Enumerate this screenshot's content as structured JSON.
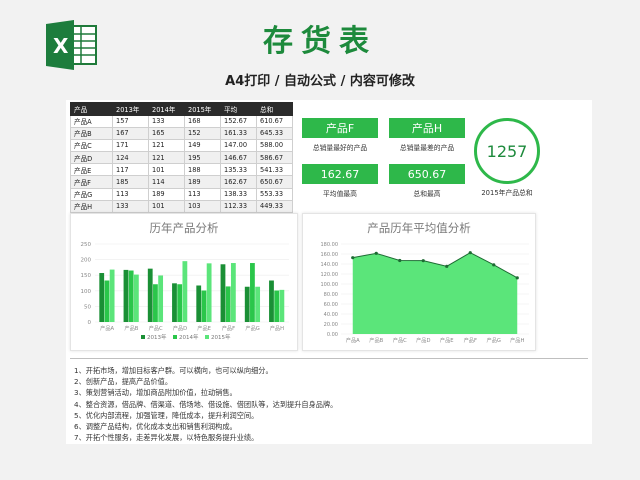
{
  "header": {
    "title": "存货表",
    "subtitle": "A4打印 / 自动公式 / 内容可修改",
    "logo_icon": "excel-logo-icon"
  },
  "colors": {
    "accent": "#2eb84a",
    "dark_green": "#1d8a3c",
    "series": [
      "#1a8f35",
      "#2ac64a",
      "#5be57a"
    ]
  },
  "table": {
    "headers": [
      "产品",
      "2013年",
      "2014年",
      "2015年",
      "平均",
      "总和"
    ],
    "rows": [
      [
        "产品A",
        "157",
        "133",
        "168",
        "152.67",
        "610.67"
      ],
      [
        "产品B",
        "167",
        "165",
        "152",
        "161.33",
        "645.33"
      ],
      [
        "产品C",
        "171",
        "121",
        "149",
        "147.00",
        "588.00"
      ],
      [
        "产品D",
        "124",
        "121",
        "195",
        "146.67",
        "586.67"
      ],
      [
        "产品E",
        "117",
        "101",
        "188",
        "135.33",
        "541.33"
      ],
      [
        "产品F",
        "185",
        "114",
        "189",
        "162.67",
        "650.67"
      ],
      [
        "产品G",
        "113",
        "189",
        "113",
        "138.33",
        "553.33"
      ],
      [
        "产品H",
        "133",
        "101",
        "103",
        "112.33",
        "449.33"
      ]
    ]
  },
  "kpis": {
    "best_seller": {
      "value": "产品F",
      "caption": "总销量最好的产品"
    },
    "worst_seller": {
      "value": "产品H",
      "caption": "总销量最差的产品"
    },
    "avg_max": {
      "value": "162.67",
      "caption": "平均值最高"
    },
    "sum_max": {
      "value": "650.67",
      "caption": "总和最高"
    },
    "total_2015": {
      "value": "1257",
      "caption": "2015年产品总和"
    }
  },
  "chart_data": [
    {
      "type": "bar",
      "title": "历年产品分析",
      "categories": [
        "产品A",
        "产品B",
        "产品C",
        "产品D",
        "产品E",
        "产品F",
        "产品G",
        "产品H"
      ],
      "series": [
        {
          "name": "2013年",
          "values": [
            157,
            167,
            171,
            124,
            117,
            185,
            113,
            133
          ]
        },
        {
          "name": "2014年",
          "values": [
            133,
            165,
            121,
            121,
            101,
            114,
            189,
            101
          ]
        },
        {
          "name": "2015年",
          "values": [
            168,
            152,
            149,
            195,
            188,
            189,
            113,
            103
          ]
        }
      ],
      "ylim": [
        0,
        250
      ],
      "yticks": [
        "0",
        "50",
        "100",
        "150",
        "200",
        "250"
      ],
      "legend": "bottom",
      "grid": true
    },
    {
      "type": "area",
      "title": "产品历年平均值分析",
      "categories": [
        "产品A",
        "产品B",
        "产品C",
        "产品D",
        "产品E",
        "产品F",
        "产品G",
        "产品H"
      ],
      "values": [
        152.67,
        161.33,
        147.0,
        146.67,
        135.33,
        162.67,
        138.33,
        112.33
      ],
      "ylim": [
        0,
        180
      ],
      "yticks": [
        "0.00",
        "20.00",
        "40.00",
        "60.00",
        "80.00",
        "100.00",
        "120.00",
        "140.00",
        "160.00",
        "180.00"
      ],
      "grid": true
    }
  ],
  "notes": [
    "1、开拓市场，增加目标客户群。可以横向，也可以纵向细分。",
    "2、创新产品，提高产品价值。",
    "3、策划营销活动，增加商品附加价值，拉动销售。",
    "4、整合资源，借品牌、借渠道、借场地、借设施、借团队等，达到提升自身品牌。",
    "5、优化内部流程，加强管理，降低成本，提升利润空间。",
    "6、调整产品结构，优化成本支出和销售利润构成。",
    "7、开拓个性服务，走差异化发展，以特色服务提升业绩。"
  ]
}
